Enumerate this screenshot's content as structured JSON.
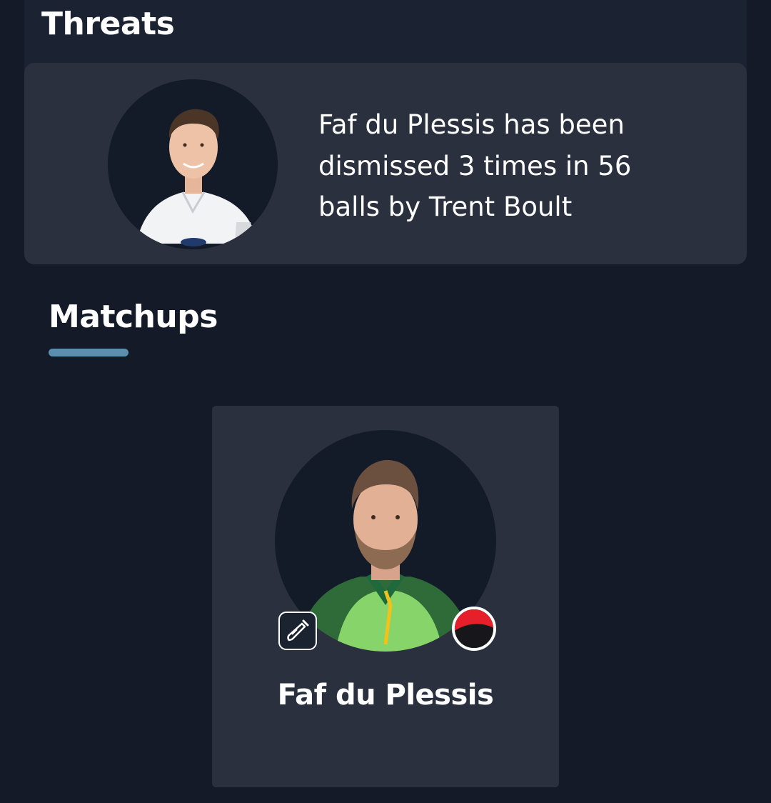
{
  "threats": {
    "title": "Threats",
    "card": {
      "text": "Faf du Plessis has been dismissed 3 times in 56 balls by Trent Boult",
      "avatar_label": "Trent Boult"
    }
  },
  "matchups": {
    "title": "Matchups",
    "card": {
      "name": "Faf du Plessis",
      "role_icon": "cricket-bat-icon",
      "team_badge_icon": "team-badge-icon"
    }
  },
  "colors": {
    "background": "#141a28",
    "card": "#2a303d",
    "accent_underline": "#5c8eb0",
    "avatar_bg": "#131a28",
    "badge_red": "#e5202b"
  }
}
